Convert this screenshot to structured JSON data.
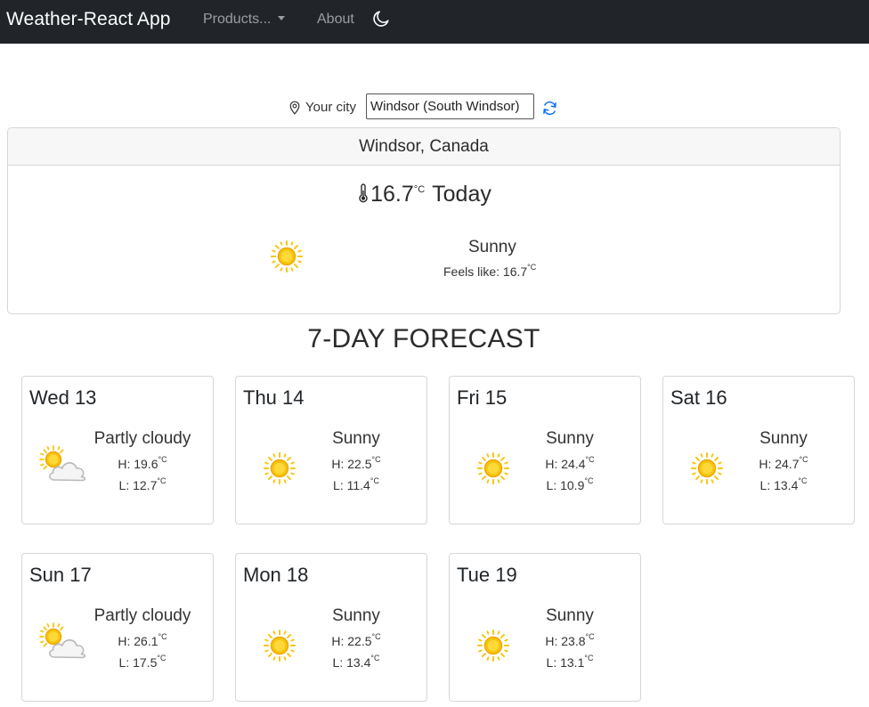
{
  "navbar": {
    "brand": "Weather-React App",
    "products_label": "Products...",
    "about_label": "About"
  },
  "search": {
    "label": "Your city",
    "value": "Windsor (South Windsor)"
  },
  "current": {
    "location": "Windsor, Canada",
    "temp": "16.7",
    "unit": "°C",
    "day_label": "Today",
    "description": "Sunny",
    "feels_like_prefix": "Feels like: ",
    "feels_like": "16.7",
    "icon": "sun-icon"
  },
  "forecast": {
    "title": "7-DAY FORECAST",
    "days": [
      {
        "name": "Wed 13",
        "description": "Partly cloudy",
        "high": "19.6",
        "low": "12.7",
        "icon": "partly-cloudy-icon"
      },
      {
        "name": "Thu 14",
        "description": "Sunny",
        "high": "22.5",
        "low": "11.4",
        "icon": "sun-icon"
      },
      {
        "name": "Fri 15",
        "description": "Sunny",
        "high": "24.4",
        "low": "10.9",
        "icon": "sun-icon"
      },
      {
        "name": "Sat 16",
        "description": "Sunny",
        "high": "24.7",
        "low": "13.4",
        "icon": "sun-icon"
      },
      {
        "name": "Sun 17",
        "description": "Partly cloudy",
        "high": "26.1",
        "low": "17.5",
        "icon": "partly-cloudy-icon"
      },
      {
        "name": "Mon 18",
        "description": "Sunny",
        "high": "22.5",
        "low": "13.4",
        "icon": "sun-icon"
      },
      {
        "name": "Tue 19",
        "description": "Sunny",
        "high": "23.8",
        "low": "13.1",
        "icon": "sun-icon"
      }
    ],
    "high_prefix": "H: ",
    "low_prefix": "L: "
  },
  "colors": {
    "navbar_bg": "#212529",
    "accent": "#0d6efd",
    "sun": "#f6c60b"
  }
}
